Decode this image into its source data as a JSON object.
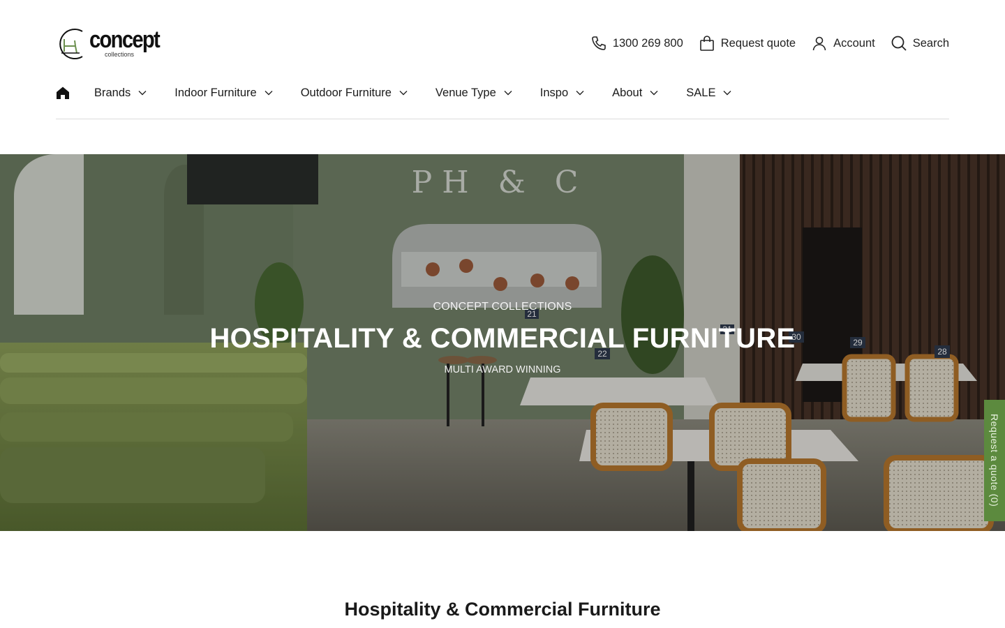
{
  "brand": {
    "name": "concept",
    "subtitle": "collections"
  },
  "utility": {
    "phone": "1300 269 800",
    "quote": "Request quote",
    "account": "Account",
    "search": "Search",
    "icons": [
      "phone-icon",
      "bag-icon",
      "user-icon",
      "search-icon"
    ]
  },
  "nav": {
    "home_icon": "home-icon",
    "items": [
      {
        "label": "Brands"
      },
      {
        "label": "Indoor Furniture"
      },
      {
        "label": "Outdoor Furniture"
      },
      {
        "label": "Venue Type"
      },
      {
        "label": "Inspo"
      },
      {
        "label": "About"
      },
      {
        "label": "SALE"
      }
    ]
  },
  "hero": {
    "eyebrow": "CONCEPT COLLECTIONS",
    "title": "HOSPITALITY & COMMERCIAL FURNITURE",
    "subtitle": "MULTI AWARD WINNING",
    "wall_sign": "PH & C",
    "table_numbers": [
      "21",
      "22",
      "31",
      "30",
      "29",
      "28"
    ]
  },
  "quote_tab": {
    "label": "Request a quote (0)"
  },
  "section": {
    "title": "Hospitality & Commercial Furniture"
  },
  "colors": {
    "accent_green": "#5c8a3e",
    "wall_green": "#7a8a66",
    "text": "#1a1a1a"
  }
}
